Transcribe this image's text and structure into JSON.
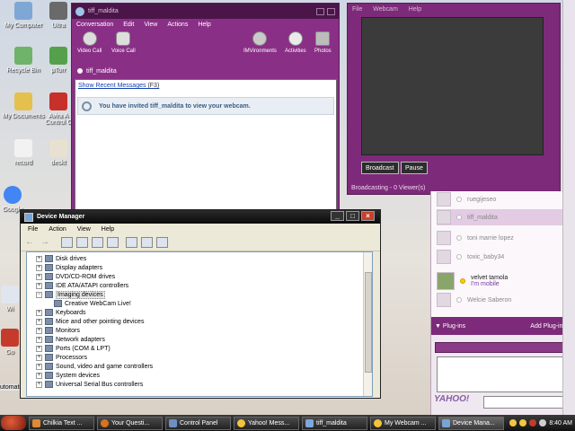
{
  "desktop_icons": [
    {
      "label": "My Computer"
    },
    {
      "label": "Ultra"
    },
    {
      "label": "Recycle Bin"
    },
    {
      "label": "µTorr"
    },
    {
      "label": "My Documents"
    },
    {
      "label": "Avira A\nControl C"
    },
    {
      "label": "record"
    },
    {
      "label": "deskt"
    },
    {
      "label": "Google"
    },
    {
      "label": "Wi"
    },
    {
      "label": "Go"
    },
    {
      "label": "utomati"
    }
  ],
  "conversation": {
    "title": "tiff_maldita",
    "menu": [
      "Conversation",
      "Edit",
      "View",
      "Actions",
      "Help"
    ],
    "toolbar_left": [
      {
        "label": "Video Call",
        "icon": "webcam-icon"
      },
      {
        "label": "Voice Call",
        "icon": "microphone-icon"
      }
    ],
    "toolbar_right": [
      {
        "label": "IMVironments",
        "icon": "imvironments-icon"
      },
      {
        "label": "Activities",
        "icon": "activities-icon"
      },
      {
        "label": "Photos",
        "icon": "photos-icon"
      }
    ],
    "contact_name": "tiff_maldita",
    "recent_link": "Show Recent Messages",
    "recent_shortcut": "(F3)",
    "notice": "You have invited tiff_maldita to view your webcam."
  },
  "webcam": {
    "menu": [
      "File",
      "Webcam",
      "Help"
    ],
    "broadcast_label": "Broadcast",
    "pause_label": "Pause",
    "status": "Broadcasting - 0 Viewer(s)"
  },
  "messenger": {
    "contacts": [
      {
        "name": "ruegijeseo",
        "online": false
      },
      {
        "name": "tiff_maldita",
        "online": false,
        "selected": true
      },
      {
        "name": "toni marrie lopez",
        "online": false
      },
      {
        "name": "toxic_baby34",
        "online": false
      },
      {
        "name": "velvet tamola",
        "online": true,
        "sub": "I'm mobile"
      },
      {
        "name": "Welcie Saberon",
        "online": false
      }
    ],
    "plugins_left": "Plug-ins",
    "plugins_right": "Add Plug-ins",
    "brand": "YAHOO!"
  },
  "device_manager": {
    "title": "Device Manager",
    "menu": [
      "File",
      "Action",
      "View",
      "Help"
    ],
    "tree": [
      {
        "label": "Disk drives",
        "expanded": false
      },
      {
        "label": "Display adapters",
        "expanded": false
      },
      {
        "label": "DVD/CD-ROM drives",
        "expanded": false
      },
      {
        "label": "IDE ATA/ATAPI controllers",
        "expanded": false
      },
      {
        "label": "Imaging devices",
        "expanded": true,
        "selected": true
      },
      {
        "label": "Creative WebCam Live!",
        "child": true
      },
      {
        "label": "Keyboards",
        "expanded": false
      },
      {
        "label": "Mice and other pointing devices",
        "expanded": false
      },
      {
        "label": "Monitors",
        "expanded": false
      },
      {
        "label": "Network adapters",
        "expanded": false
      },
      {
        "label": "Ports (COM & LPT)",
        "expanded": false
      },
      {
        "label": "Processors",
        "expanded": false
      },
      {
        "label": "Sound, video and game controllers",
        "expanded": false
      },
      {
        "label": "System devices",
        "expanded": false
      },
      {
        "label": "Universal Serial Bus controllers",
        "expanded": false
      }
    ]
  },
  "taskbar": {
    "tasks": [
      {
        "label": "Chilkia Text ..."
      },
      {
        "label": "Your Questi..."
      },
      {
        "label": "Control Panel"
      },
      {
        "label": "Yahoo! Mess..."
      },
      {
        "label": "tiff_maldita"
      },
      {
        "label": "My Webcam ..."
      },
      {
        "label": "Device Mana...",
        "active": true
      }
    ],
    "clock": "8:40 AM"
  }
}
